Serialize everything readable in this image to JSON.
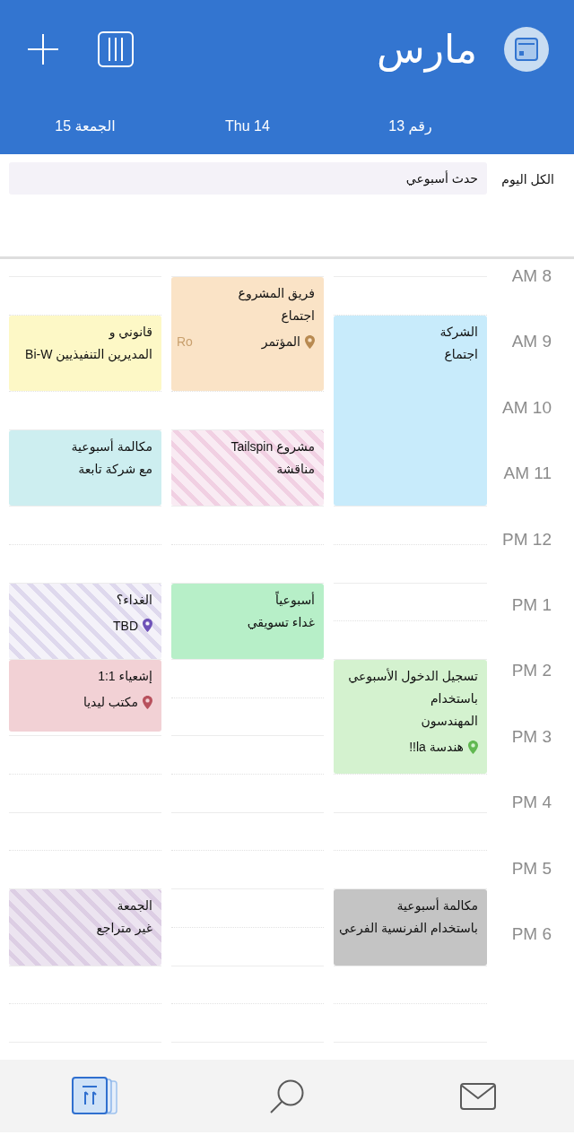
{
  "header": {
    "title": "مارس"
  },
  "all_day": {
    "label": "الكل اليوم",
    "events": [
      {
        "title": "حدث أسبوعي",
        "color": "#f4f2f8"
      }
    ]
  },
  "time_labels": [
    "8 AM",
    "9 AM",
    "10 AM",
    "11 AM",
    "12 PM",
    "1 PM",
    "2 PM",
    "3 PM",
    "4 PM",
    "5 PM",
    "6 PM"
  ],
  "days": [
    {
      "label": "رقم 13",
      "events": [
        {
          "lines": [
            "الشركة",
            "اجتماع"
          ],
          "color": "#c8ebfb",
          "tentative": false
        },
        {
          "lines": [
            "تسجيل الدخول الأسبوعي",
            "باستخدام",
            "المهندسون"
          ],
          "location": {
            "text": "هندسة la!!"
          },
          "color": "#d4f2cf",
          "tentative": false
        },
        {
          "lines": [
            "مكالمة أسبوعية",
            "باستخدام الفرنسية الفرعي"
          ],
          "color": "#c4c4c4",
          "tentative": false
        }
      ]
    },
    {
      "label": "Thu 14",
      "events": [
        {
          "lines": [
            "فريق المشروع",
            "اجتماع"
          ],
          "location": {
            "text": "المؤتمر",
            "cut": "Ro"
          },
          "color": "#fae3c6",
          "tentative": false
        },
        {
          "lines": [
            "مشروع Tailspin",
            "مناقشة"
          ],
          "color": "#f9ebf3",
          "tentative": true
        },
        {
          "lines": [
            "أسبوعياً",
            "غداء تسويقي"
          ],
          "color": "#b7efc8",
          "tentative": false
        }
      ]
    },
    {
      "label": "الجمعة 15",
      "events": [
        {
          "lines": [
            "قانوني و",
            "المديرين التنفيذيين Bi-W"
          ],
          "color": "#fdf8c6",
          "tentative": false
        },
        {
          "lines": [
            "مكالمة أسبوعية",
            "مع شركة تابعة"
          ],
          "color": "#cdeef0",
          "tentative": false
        },
        {
          "lines": [
            "الغداء؟"
          ],
          "location": {
            "text": "TBD"
          },
          "color": "#f4f2f9",
          "tentative": true
        },
        {
          "lines": [
            "إشعياء 1:1"
          ],
          "location": {
            "text": "مكتب ليديا"
          },
          "color": "#f2d1d5",
          "tentative": false
        },
        {
          "lines": [
            "الجمعة",
            "غير متراجع"
          ],
          "color": "#ece4f0",
          "tentative": true
        }
      ]
    }
  ],
  "tab_bar": {
    "tabs": [
      {
        "kind": "calendar",
        "selected": true
      },
      {
        "kind": "search",
        "selected": false
      },
      {
        "kind": "mail",
        "selected": false
      }
    ]
  }
}
